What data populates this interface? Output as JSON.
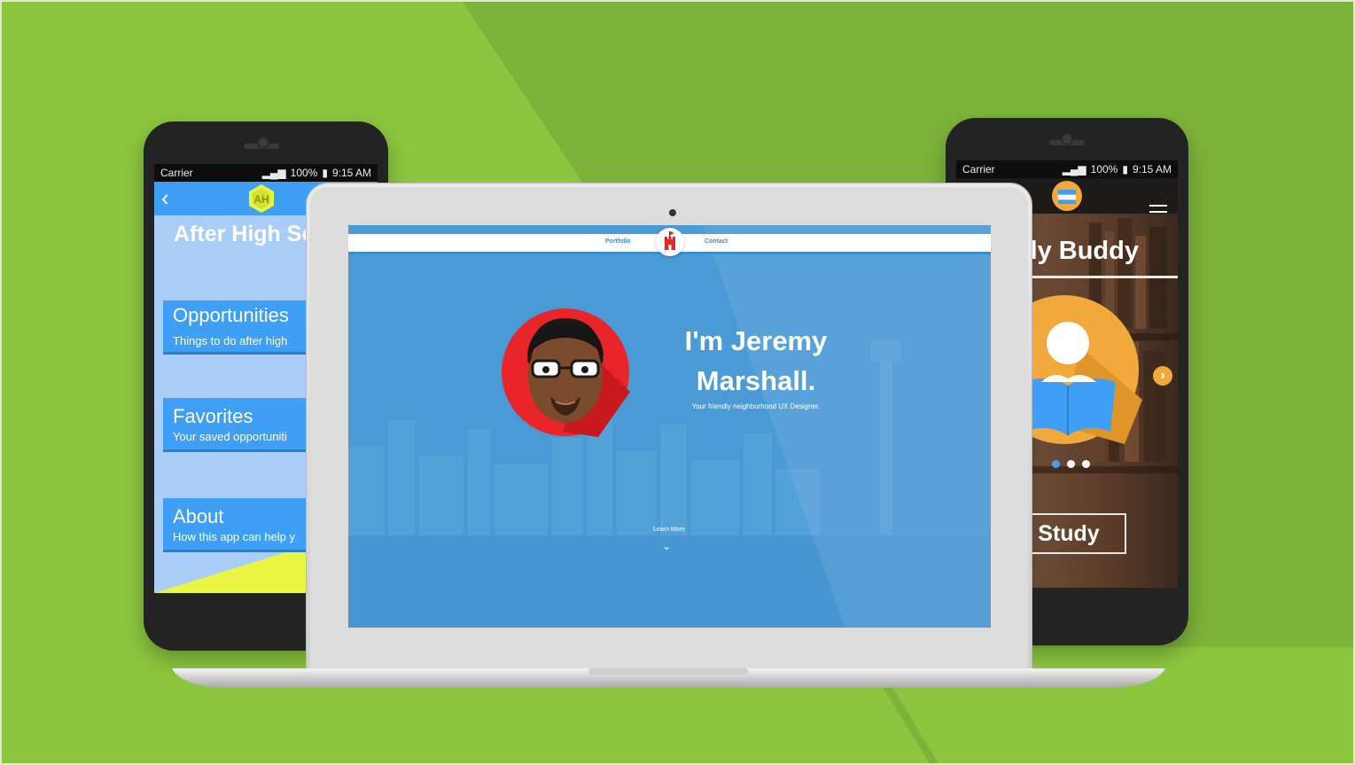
{
  "colors": {
    "background_green": "#8cc63f",
    "background_green_dark": "#7db33a",
    "app_blue": "#3f9ff5",
    "app_light_blue": "#a9cdf7",
    "app_yellow": "#e9f542",
    "portfolio_blue": "#4a9ad6",
    "avatar_red": "#e8262a",
    "book_orange": "#f2a93b"
  },
  "left_phone": {
    "status": {
      "carrier": "Carrier",
      "signal": "100%",
      "time": "9:15 AM"
    },
    "icons": {
      "back": "chevron-left-icon",
      "logo": "after-high-school-logo-icon"
    },
    "hero_title": "After High Sc",
    "cards": [
      {
        "title": "Opportunities",
        "subtitle": "Things to do after high"
      },
      {
        "title": "Favorites",
        "subtitle": "Your saved opportuniti"
      },
      {
        "title": "About",
        "subtitle": "How this app can help y"
      }
    ]
  },
  "laptop": {
    "nav": {
      "left": "Portfolio",
      "right": "Contact"
    },
    "headline_line1": "I'm Jeremy",
    "headline_line2": "Marshall.",
    "tagline": "Your friendly neighborhood UX Designer.",
    "learn_more": "Learn More",
    "icons": {
      "logo": "castle-logo-icon",
      "avatar": "avatar-illustration",
      "scroll": "chevron-down-icon"
    }
  },
  "right_phone": {
    "status": {
      "carrier": "Carrier",
      "signal": "100%",
      "time": "9:15 AM"
    },
    "title": "dy Buddy",
    "button": "Study",
    "carousel": {
      "count": 3,
      "active": 1
    },
    "icons": {
      "logo": "books-logo-icon",
      "menu": "hamburger-menu-icon",
      "next": "chevron-right-icon",
      "hero": "reading-person-icon"
    }
  }
}
